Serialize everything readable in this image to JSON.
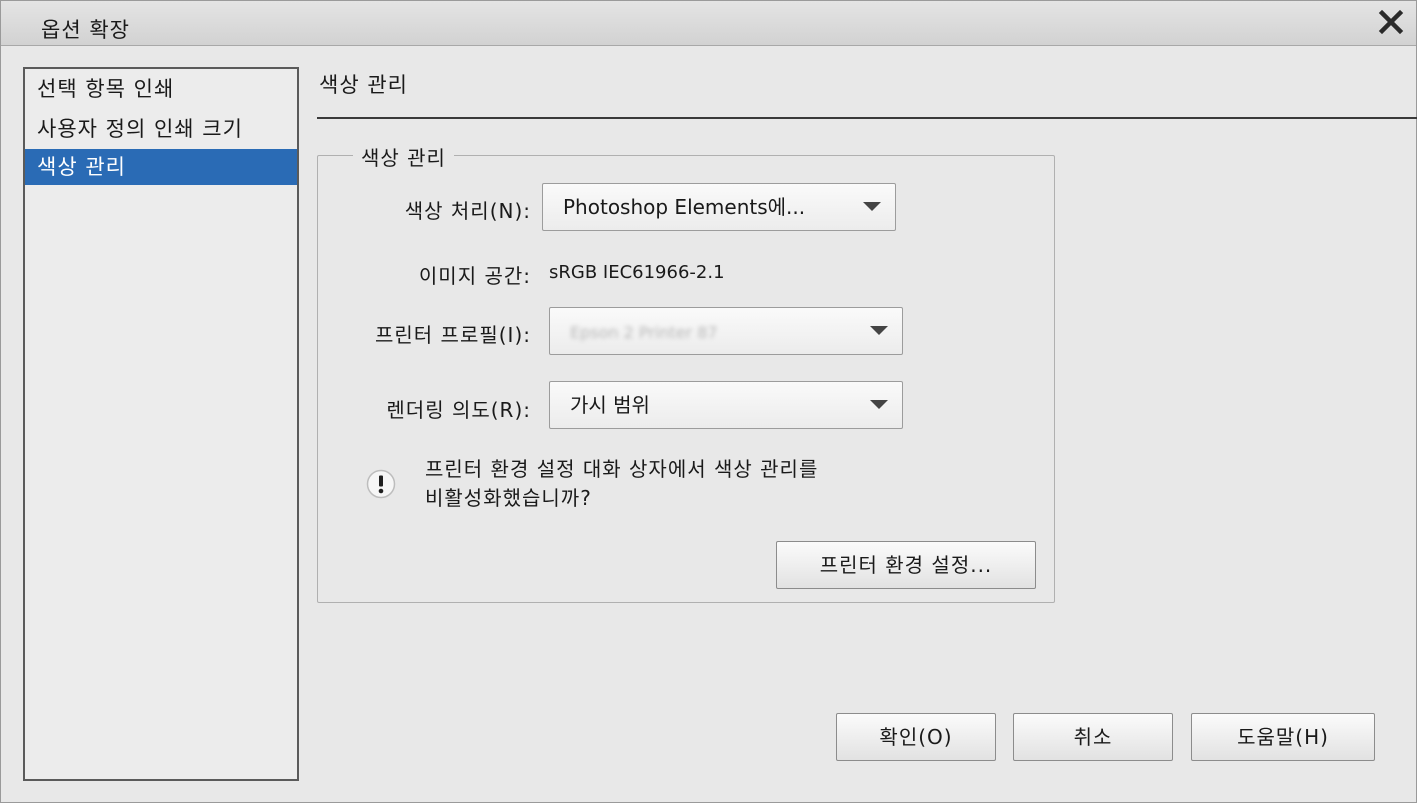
{
  "window": {
    "title": "옵션 확장",
    "close_icon": "close-icon"
  },
  "sidebar": {
    "items": [
      {
        "label": "선택 항목 인쇄",
        "selected": false
      },
      {
        "label": "사용자 정의 인쇄 크기",
        "selected": false
      },
      {
        "label": "색상 관리",
        "selected": true
      }
    ]
  },
  "main": {
    "section_title": "색상 관리",
    "group": {
      "legend": "색상 관리",
      "color_handling": {
        "label": "색상 처리(N):",
        "value": "Photoshop  Elements에..."
      },
      "image_space": {
        "label": "이미지 공간:",
        "value": "sRGB IEC61966-2.1"
      },
      "printer_profile": {
        "label": "프린터 프로필(I):",
        "value": "Epson 2 Printer 87",
        "blurred": true
      },
      "rendering_intent": {
        "label": "렌더링 의도(R):",
        "value": "가시 범위"
      },
      "warning": {
        "icon": "exclamation-icon",
        "line1": "프린터 환경 설정 대화 상자에서 색상 관리를",
        "line2": "비활성화했습니까?"
      },
      "printer_prefs_button": "프린터 환경 설정..."
    }
  },
  "footer": {
    "ok_label": "확인(O)",
    "cancel_label": "취소",
    "help_label": "도움말(H)"
  },
  "colors": {
    "selection": "#2a6bb5",
    "background": "#e8e8e8"
  }
}
